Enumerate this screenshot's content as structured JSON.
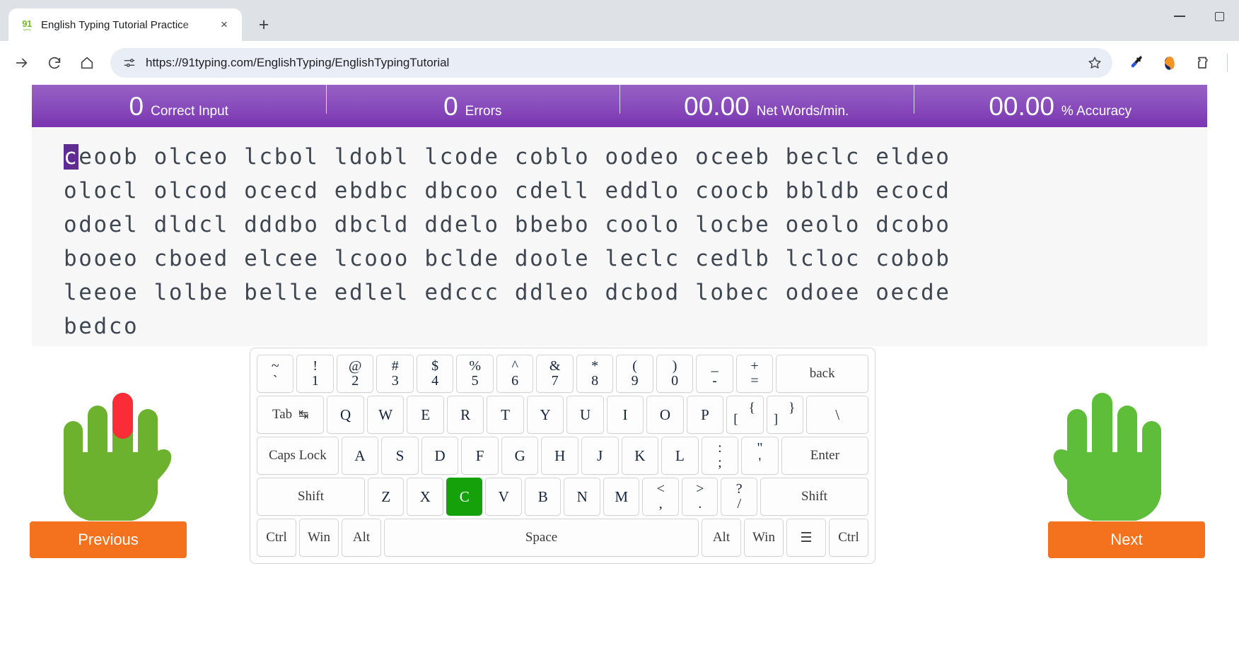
{
  "browser": {
    "tab": {
      "title": "English Typing Tutorial Practice",
      "favicon": "91typing-logo-icon",
      "close": "×"
    },
    "new_tab_label": "+",
    "url": "https://91typing.com/EnglishTyping/EnglishTypingTutorial",
    "toolbar": {
      "forward": "forward-arrow-icon",
      "reload": "reload-icon",
      "home": "home-icon",
      "site_info": "site-settings-icon",
      "bookmark": "star-icon",
      "eyedropper": "eyedropper-extension-icon",
      "extension_color": "colorpick-extension-icon",
      "extensions": "extensions-puzzle-icon"
    },
    "window": {
      "minimize": "minimize-icon",
      "maximize": "maximize-icon"
    }
  },
  "stats": [
    {
      "value": "0",
      "label": "Correct Input"
    },
    {
      "value": "0",
      "label": "Errors"
    },
    {
      "value": "00.00",
      "label": "Net Words/min."
    },
    {
      "value": "00.00",
      "label": "% Accuracy"
    }
  ],
  "typing": {
    "cursor_char": "c",
    "lines": [
      "eoob olceo lcbol ldobl lcode coblo oodeo oceeb beclc eldeo",
      "olocl olcod ocecd ebdbc dbcoo cdell eddlo coocb bbldb ecocd",
      "odoel dldcl dddbo dbcld ddelo bbebo coolo locbe oeolo dcobo",
      "booeo cboed elcee lcooo bclde doole leclc cedlb lcloc cobob",
      "leeoe lolbe belle edlel edccc ddleo dcbod lobec odoee oecde",
      "bedco"
    ]
  },
  "buttons": {
    "previous": "Previous",
    "next": "Next"
  },
  "hands": {
    "left": {
      "name": "left-hand-diagram",
      "highlight_finger": "middle",
      "highlight_color": "#fa2c37",
      "color": "#6cb22e"
    },
    "right": {
      "name": "right-hand-diagram",
      "color": "#5ebe3a"
    }
  },
  "keyboard": {
    "active_key": "C",
    "active_color": "#14a10a",
    "rows": [
      [
        {
          "top": "~",
          "bot": "`",
          "type": "dual"
        },
        {
          "top": "!",
          "bot": "1",
          "type": "dual"
        },
        {
          "top": "@",
          "bot": "2",
          "type": "dual"
        },
        {
          "top": "#",
          "bot": "3",
          "type": "dual"
        },
        {
          "top": "$",
          "bot": "4",
          "type": "dual"
        },
        {
          "top": "%",
          "bot": "5",
          "type": "dual"
        },
        {
          "top": "^",
          "bot": "6",
          "type": "dual"
        },
        {
          "top": "&",
          "bot": "7",
          "type": "dual"
        },
        {
          "top": "*",
          "bot": "8",
          "type": "dual"
        },
        {
          "top": "(",
          "bot": "9",
          "type": "dual"
        },
        {
          "top": ")",
          "bot": "0",
          "type": "dual"
        },
        {
          "top": "_",
          "bot": "-",
          "type": "dual"
        },
        {
          "top": "+",
          "bot": "=",
          "type": "dual"
        },
        {
          "label": "back",
          "type": "mod",
          "width": "wide-back"
        }
      ],
      [
        {
          "label": "Tab",
          "icon": "↹",
          "type": "tab",
          "width": "wide-tab"
        },
        {
          "label": "Q",
          "type": "letter"
        },
        {
          "label": "W",
          "type": "letter"
        },
        {
          "label": "E",
          "type": "letter"
        },
        {
          "label": "R",
          "type": "letter"
        },
        {
          "label": "T",
          "type": "letter"
        },
        {
          "label": "Y",
          "type": "letter"
        },
        {
          "label": "U",
          "type": "letter"
        },
        {
          "label": "I",
          "type": "letter"
        },
        {
          "label": "O",
          "type": "letter"
        },
        {
          "label": "P",
          "type": "letter"
        },
        {
          "top": "{",
          "bot": "[",
          "type": "offset"
        },
        {
          "top": "}",
          "bot": "]",
          "type": "offset"
        },
        {
          "label": "\\",
          "type": "letter",
          "width": "wide-bslash"
        }
      ],
      [
        {
          "label": "Caps Lock",
          "type": "mod",
          "width": "wide-caps"
        },
        {
          "label": "A",
          "type": "letter"
        },
        {
          "label": "S",
          "type": "letter"
        },
        {
          "label": "D",
          "type": "letter"
        },
        {
          "label": "F",
          "type": "letter"
        },
        {
          "label": "G",
          "type": "letter"
        },
        {
          "label": "H",
          "type": "letter"
        },
        {
          "label": "J",
          "type": "letter"
        },
        {
          "label": "K",
          "type": "letter"
        },
        {
          "label": "L",
          "type": "letter"
        },
        {
          "top": ":",
          "bot": ";",
          "type": "dual"
        },
        {
          "top": "\"",
          "bot": "'",
          "type": "dual"
        },
        {
          "label": "Enter",
          "type": "mod",
          "width": "wide-enter"
        }
      ],
      [
        {
          "label": "Shift",
          "type": "mod",
          "width": "wide-shiftl"
        },
        {
          "label": "Z",
          "type": "letter"
        },
        {
          "label": "X",
          "type": "letter"
        },
        {
          "label": "C",
          "type": "letter"
        },
        {
          "label": "V",
          "type": "letter"
        },
        {
          "label": "B",
          "type": "letter"
        },
        {
          "label": "N",
          "type": "letter"
        },
        {
          "label": "M",
          "type": "letter"
        },
        {
          "top": "<",
          "bot": ",",
          "type": "dual"
        },
        {
          "top": ">",
          "bot": ".",
          "type": "dual"
        },
        {
          "top": "?",
          "bot": "/",
          "type": "dual"
        },
        {
          "label": "Shift",
          "type": "mod",
          "width": "wide-shiftr"
        }
      ],
      [
        {
          "label": "Ctrl",
          "type": "mod"
        },
        {
          "label": "Win",
          "type": "mod"
        },
        {
          "label": "Alt",
          "type": "mod"
        },
        {
          "label": "Space",
          "type": "mod",
          "width": "wide-space"
        },
        {
          "label": "Alt",
          "type": "mod"
        },
        {
          "label": "Win",
          "type": "mod"
        },
        {
          "label": "☰",
          "type": "menu"
        },
        {
          "label": "Ctrl",
          "type": "mod"
        }
      ]
    ]
  }
}
